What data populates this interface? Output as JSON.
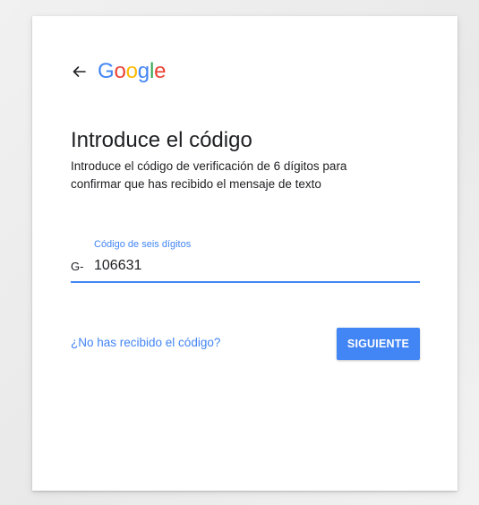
{
  "header": {
    "back_icon": "arrow-left-icon",
    "logo_letters": [
      "G",
      "o",
      "o",
      "g",
      "l",
      "e"
    ],
    "logo_colors": [
      "#4285f4",
      "#ea4335",
      "#fbbc05",
      "#4285f4",
      "#34a853",
      "#ea4335"
    ]
  },
  "main": {
    "title": "Introduce el código",
    "subtitle": "Introduce el código de verificación de 6 dígitos para confirmar que has recibido el mensaje de texto"
  },
  "code_field": {
    "label": "Código de seis dígitos",
    "prefix": "G-",
    "value": "106631"
  },
  "actions": {
    "resend_link": "¿No has recibido el código?",
    "next_label": "SIGUIENTE"
  },
  "colors": {
    "accent": "#4285f4",
    "text": "#202124",
    "background": "#ececec",
    "card": "#ffffff"
  }
}
